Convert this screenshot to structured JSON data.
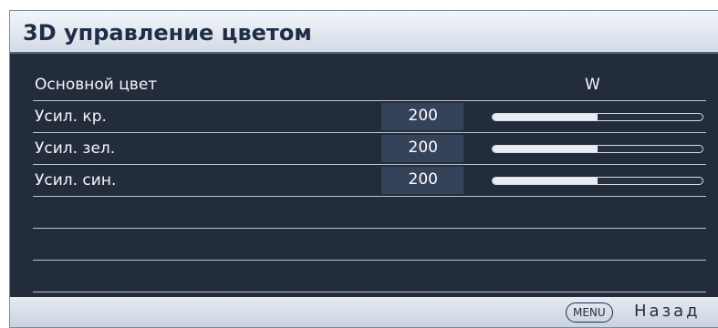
{
  "title": "3D управление цветом",
  "primary_color": {
    "label": "Основной цвет",
    "value": "W"
  },
  "rows": [
    {
      "label": "Усил. кр.",
      "value": "200",
      "level": 0.5
    },
    {
      "label": "Усил. зел.",
      "value": "200",
      "level": 0.5
    },
    {
      "label": "Усил. син.",
      "value": "200",
      "level": 0.5
    }
  ],
  "footer": {
    "menu_key": "MENU",
    "back_label": "Назад"
  },
  "colors": {
    "panel_bg": "#232c3b",
    "title_bar": "#e6ebf2",
    "value_box": "#34435a",
    "text": "#f4f6fa"
  }
}
